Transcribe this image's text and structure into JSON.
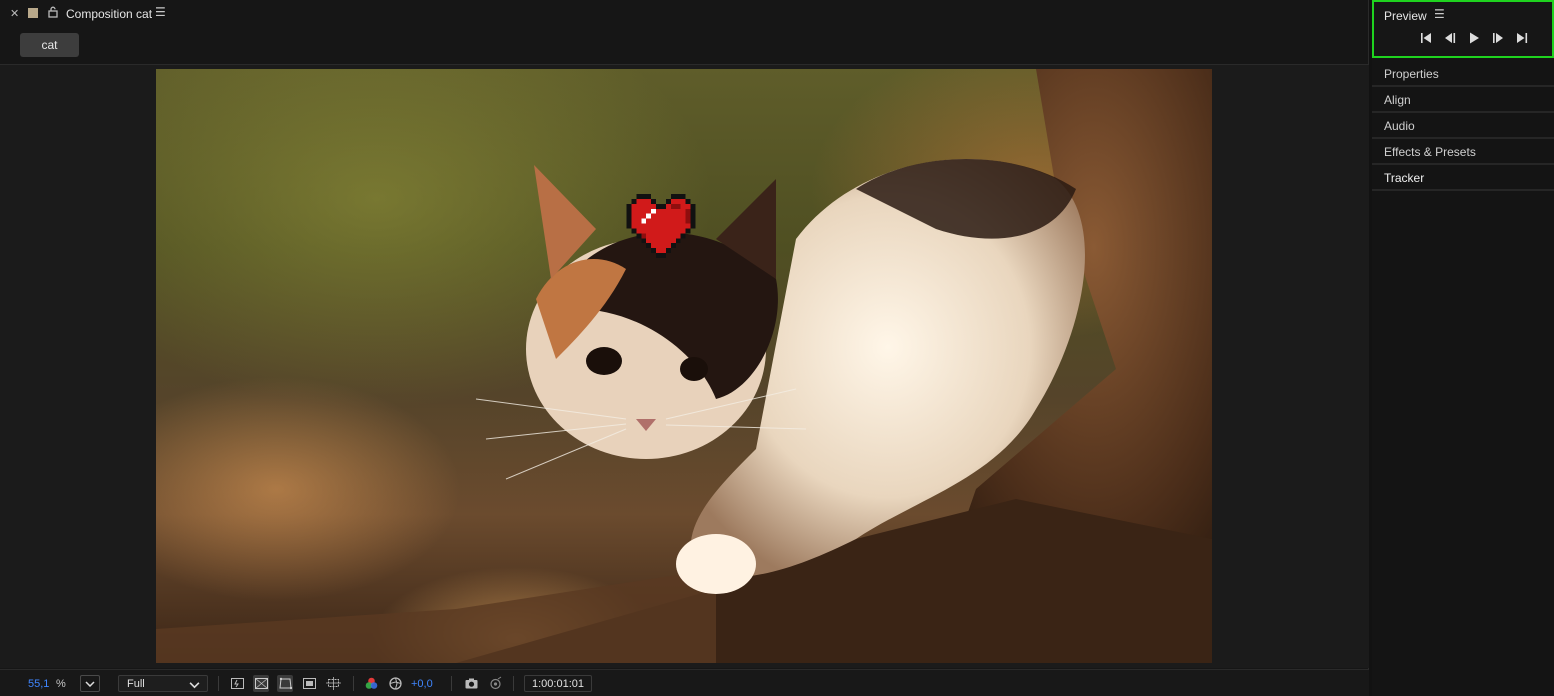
{
  "composition": {
    "title": "Composition cat",
    "tab_label": "cat",
    "icons": {
      "close": "close-icon",
      "label_swatch": "label-color-icon",
      "lock": "lock-icon",
      "menu": "hamburger-menu-icon"
    },
    "label_color": "#b9a98b"
  },
  "toolbar": {
    "zoom_value": "55,1",
    "zoom_unit": "%",
    "resolution": "Full",
    "exposure": "+0,0",
    "timecode": "1:00:01:01",
    "icons": [
      "fast-previews-icon",
      "transparency-grid-icon",
      "mask-visibility-icon",
      "region-of-interest-icon",
      "grid-guides-icon",
      "channel-icon",
      "reset-exposure-icon",
      "snapshot-icon",
      "show-snapshot-icon"
    ],
    "accent_color": "#3f86ff"
  },
  "preview_panel": {
    "title": "Preview",
    "controls": [
      "first-frame-icon",
      "previous-frame-icon",
      "play-icon",
      "next-frame-icon",
      "last-frame-icon"
    ],
    "highlight_color": "#1fd31f"
  },
  "side_panels": [
    "Properties",
    "Align",
    "Audio",
    "Effects & Presets",
    "Tracker"
  ],
  "viewer": {
    "image": "kitten-footage",
    "overlay": "pixel-heart-icon",
    "overlay_color": "#d11a1a"
  }
}
